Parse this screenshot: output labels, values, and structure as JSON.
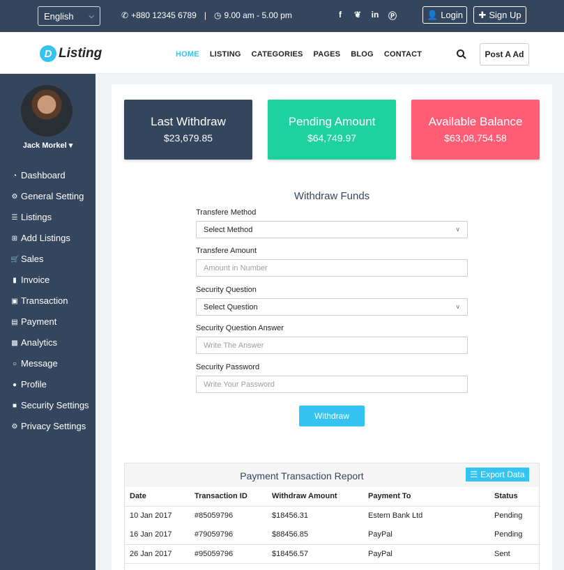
{
  "topbar": {
    "language": "English",
    "phone": "+880 12345 6789",
    "hours": "9.00 am - 5.00 pm",
    "social_icons": [
      "facebook-icon",
      "twitter-icon",
      "linkedin-icon",
      "pinterest-icon"
    ],
    "login_label": "Login",
    "signup_label": "Sign Up"
  },
  "header": {
    "logo_letter": "D",
    "logo_text": "Listing",
    "nav": [
      "HOME",
      "LISTING",
      "CATEGORIES",
      "PAGES",
      "BLOG",
      "CONTACT"
    ],
    "active_nav": "HOME",
    "post_ad_label": "Post A Ad"
  },
  "sidebar": {
    "username": "Jack Morkel",
    "items": [
      {
        "label": "Dashboard",
        "icon": "dashboard-icon"
      },
      {
        "label": "General Setting",
        "icon": "gear-icon"
      },
      {
        "label": "Listings",
        "icon": "list-icon"
      },
      {
        "label": "Add Listings",
        "icon": "plus-square-icon"
      },
      {
        "label": "Sales",
        "icon": "cart-icon"
      },
      {
        "label": "Invoice",
        "icon": "file-icon"
      },
      {
        "label": "Transaction",
        "icon": "money-icon"
      },
      {
        "label": "Payment",
        "icon": "credit-card-icon"
      },
      {
        "label": "Analytics",
        "icon": "bar-chart-icon"
      },
      {
        "label": "Message",
        "icon": "comment-icon"
      },
      {
        "label": "Profile",
        "icon": "user-icon"
      },
      {
        "label": "Security Settings",
        "icon": "lock-icon"
      },
      {
        "label": "Privacy Settings",
        "icon": "gear-icon"
      }
    ]
  },
  "stats": [
    {
      "title": "Last Withdraw",
      "value": "$23,679.85",
      "color": "#34465d"
    },
    {
      "title": "Pending Amount",
      "value": "$64,749.97",
      "color": "#1ed2a0"
    },
    {
      "title": "Available Balance",
      "value": "$63,08,754.58",
      "color": "#fd5e76"
    }
  ],
  "form": {
    "title": "Withdraw Funds",
    "method_label": "Transfere Method",
    "method_value": "Select Method",
    "amount_label": "Transfere Amount",
    "amount_placeholder": "Amount in Number",
    "question_label": "Security Question",
    "question_value": "Select Question",
    "answer_label": "Security Question Answer",
    "answer_placeholder": "Write The Answer",
    "password_label": "Security Password",
    "password_placeholder": "Write Your Password",
    "submit_label": "Withdraw"
  },
  "report": {
    "title": "Payment Transaction Report",
    "export_label": "Export Data",
    "columns": [
      "Date",
      "Transaction ID",
      "Withdraw Amount",
      "Payment To",
      "Status"
    ],
    "rows": [
      [
        "10 Jan 2017",
        "#85059796",
        "$18456.31",
        "Estern Bank Ltd",
        "Pending"
      ],
      [
        "16 Jan 2017",
        "#79059796",
        "$88456.85",
        "PayPal",
        "Pending"
      ],
      [
        "26 Jan 2017",
        "#95059796",
        "$18456.57",
        "PayPal",
        "Sent"
      ]
    ]
  },
  "colors": {
    "accent": "#35c4f1",
    "dark": "#34465d",
    "green": "#1ed2a0",
    "red": "#fd5e76"
  }
}
